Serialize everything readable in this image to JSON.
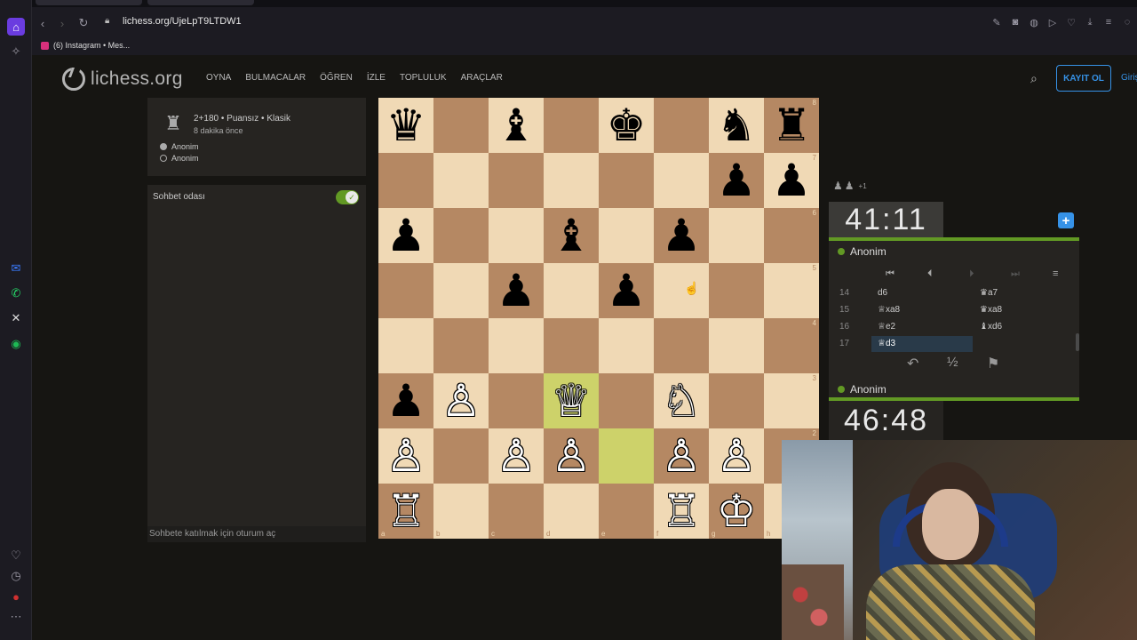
{
  "browser": {
    "url": "lichess.org/UjeLpT9LTDW1",
    "bookmark": "(6) Instagram • Mes..."
  },
  "site": {
    "logo_text": "lichess.org",
    "nav": [
      "OYNA",
      "BULMACALAR",
      "ÖĞREN",
      "İZLE",
      "TOPLULUK",
      "ARAÇLAR"
    ],
    "signup_label": "KAYIT OL",
    "login_label": "Giriş"
  },
  "game_info": {
    "variant": "2+180 • Puansız • Klasik",
    "time_ago": "8 dakika önce",
    "player_white": "Anonim",
    "player_black": "Anonim"
  },
  "chat": {
    "title": "Sohbet odası",
    "enabled": true,
    "input_placeholder": "Sohbete katılmak için oturum aç"
  },
  "board": {
    "orientation": "white",
    "position": [
      [
        "bq",
        "",
        "bb",
        "",
        "bk",
        "",
        "bn",
        "br"
      ],
      [
        "",
        "",
        "",
        "",
        "",
        "",
        "bp",
        "bp"
      ],
      [
        "bp",
        "",
        "",
        "bb",
        "",
        "bp",
        "",
        ""
      ],
      [
        "",
        "",
        "bp",
        "",
        "bp",
        "",
        "",
        ""
      ],
      [
        "",
        "",
        "",
        "",
        "",
        "",
        "",
        ""
      ],
      [
        "bp",
        "wp",
        "",
        "wq",
        "",
        "wn",
        "",
        ""
      ],
      [
        "wp",
        "",
        "wp",
        "wp",
        "",
        "wp",
        "wp",
        ""
      ],
      [
        "wr",
        "",
        "",
        "",
        "",
        "wr",
        "wk",
        ""
      ]
    ],
    "highlight": [
      "d3",
      "e2"
    ],
    "files": [
      "a",
      "b",
      "c",
      "d",
      "e",
      "f",
      "g",
      "h"
    ],
    "ranks": [
      "8",
      "7",
      "6",
      "5",
      "4",
      "3",
      "2",
      "1"
    ]
  },
  "right_panel": {
    "pocket_label": "+1",
    "clock_top": "41:11",
    "clock_bottom": "46:48",
    "opponent": "Anonim",
    "player": "Anonim",
    "moves": [
      {
        "num": "14",
        "white": "d6",
        "black": "♛a7"
      },
      {
        "num": "15",
        "white": "♕xa8",
        "black": "♛xa8"
      },
      {
        "num": "16",
        "white": "♕e2",
        "black": "♝xd6"
      },
      {
        "num": "17",
        "white": "♕d3",
        "black": ""
      }
    ],
    "draw_label": "½"
  }
}
